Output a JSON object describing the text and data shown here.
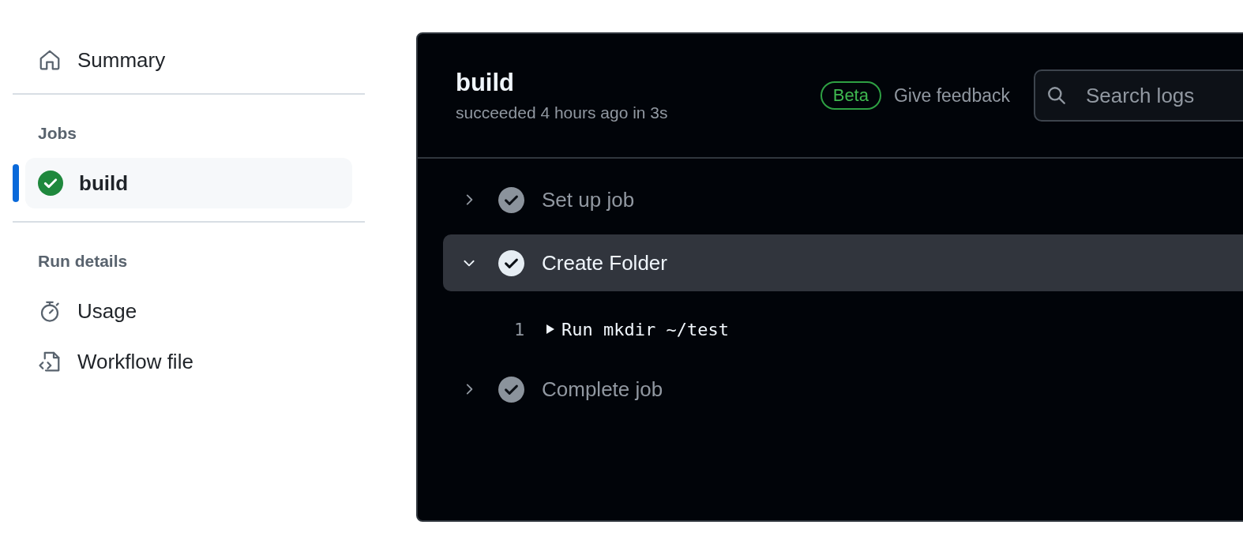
{
  "sidebar": {
    "top_items": [
      {
        "label": "Summary",
        "kind": "home"
      }
    ],
    "sections": [
      {
        "heading": "Jobs",
        "items": [
          {
            "label": "build",
            "kind": "job",
            "selected": true
          }
        ]
      },
      {
        "heading": "Run details",
        "items": [
          {
            "label": "Usage",
            "kind": "timer"
          },
          {
            "label": "Workflow file",
            "kind": "file"
          }
        ]
      }
    ]
  },
  "log_panel": {
    "title": "build",
    "subtitle": "succeeded 4 hours ago in 3s",
    "badge": "Beta",
    "feedback_link": "Give feedback",
    "search": {
      "placeholder": "Search logs"
    },
    "steps": [
      {
        "name": "Set up job",
        "expanded": false
      },
      {
        "name": "Create Folder",
        "expanded": true,
        "lines": [
          {
            "number": "1",
            "text": "Run mkdir ~/test"
          }
        ]
      },
      {
        "name": "Complete job",
        "expanded": false
      }
    ]
  }
}
